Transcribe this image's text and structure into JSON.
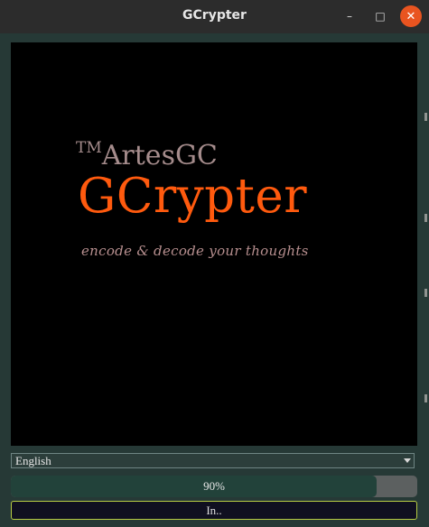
{
  "window": {
    "title": "GCrypter",
    "controls": {
      "minimize": "–",
      "maximize": "□",
      "close": "✕"
    }
  },
  "splash": {
    "tm": "TM",
    "company": "ArtesGC",
    "app_name": "GCrypter",
    "tagline": "encode & decode your thoughts"
  },
  "language_select": {
    "value": "English"
  },
  "progress": {
    "value": 0.9,
    "label": "90%"
  },
  "action_button": {
    "label": "In.."
  },
  "colors": {
    "brand_accent": "#ff5a0e",
    "progress_fill": "#22423a",
    "close_button": "#e95420"
  }
}
